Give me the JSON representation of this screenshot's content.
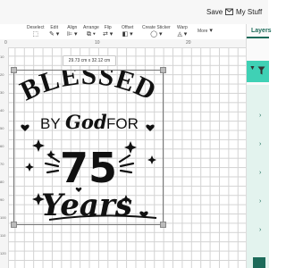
{
  "header": {
    "save_label": "Save",
    "mystuff_label": "My Stuff"
  },
  "toolbar": {
    "tools": [
      {
        "label": "Deselect",
        "icon": "⬚"
      },
      {
        "label": "Edit",
        "icon": "✎ ▾"
      },
      {
        "label": "Align",
        "icon": "⊫ ▾"
      },
      {
        "label": "Arrange",
        "icon": "⧉ ▾"
      },
      {
        "label": "Flip",
        "icon": "⇄ ▾"
      },
      {
        "label": "Offset",
        "icon": "◧ ▾"
      },
      {
        "label": "Create Sticker",
        "icon": "◯ ▾"
      },
      {
        "label": "Warp",
        "icon": "◬ ▾"
      },
      {
        "label": "More",
        "icon": "▾"
      }
    ]
  },
  "layers": {
    "title": "Layers",
    "expand_icon": "chevron-right-icon"
  },
  "ruler": {
    "top_numbers": [
      "0",
      "10",
      "20"
    ],
    "left_numbers": [
      "10",
      "20",
      "30",
      "40",
      "50",
      "60",
      "70",
      "80",
      "90",
      "100",
      "110",
      "120"
    ]
  },
  "canvas": {
    "dimension_label": "29.73 cm x 32.12 cm",
    "design": {
      "line1": "BLESSED",
      "line2_by": "BY",
      "line2_god": "God",
      "line2_for": "FOR",
      "number": "75",
      "line4": "Years"
    }
  },
  "colors": {
    "accent": "#1d6b5a",
    "layers_highlight": "#3fd1b5",
    "selected_row": "#e3f3ee"
  }
}
